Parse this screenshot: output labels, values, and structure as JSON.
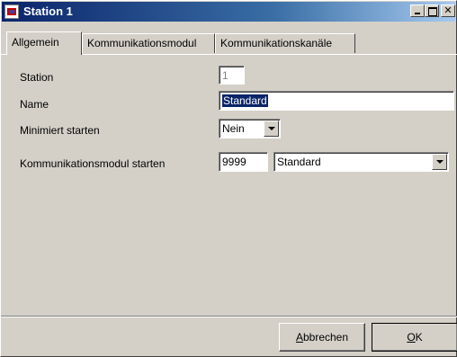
{
  "window": {
    "title": "Station 1"
  },
  "tabs": [
    {
      "label": "Allgemein",
      "active": true
    },
    {
      "label": "Kommunikationsmodul",
      "active": false
    },
    {
      "label": "Kommunikationskanäle",
      "active": false
    }
  ],
  "form": {
    "station": {
      "label": "Station",
      "value": "1"
    },
    "name": {
      "label": "Name",
      "value": "Standard"
    },
    "minimized": {
      "label": "Minimiert starten",
      "value": "Nein"
    },
    "comm_module": {
      "label": "Kommunikationsmodul starten",
      "port": "9999",
      "module": "Standard"
    }
  },
  "buttons": {
    "cancel_accel": "A",
    "cancel_rest": "bbrechen",
    "ok_accel": "O",
    "ok_rest": "K"
  },
  "colors": {
    "titlebar_start": "#0a246a",
    "titlebar_end": "#a6caf0",
    "face": "#d4d0c8",
    "selection": "#0a246a"
  },
  "icons": [
    "app-icon",
    "minimize-icon",
    "maximize-icon",
    "close-icon",
    "dropdown-arrow-icon"
  ]
}
